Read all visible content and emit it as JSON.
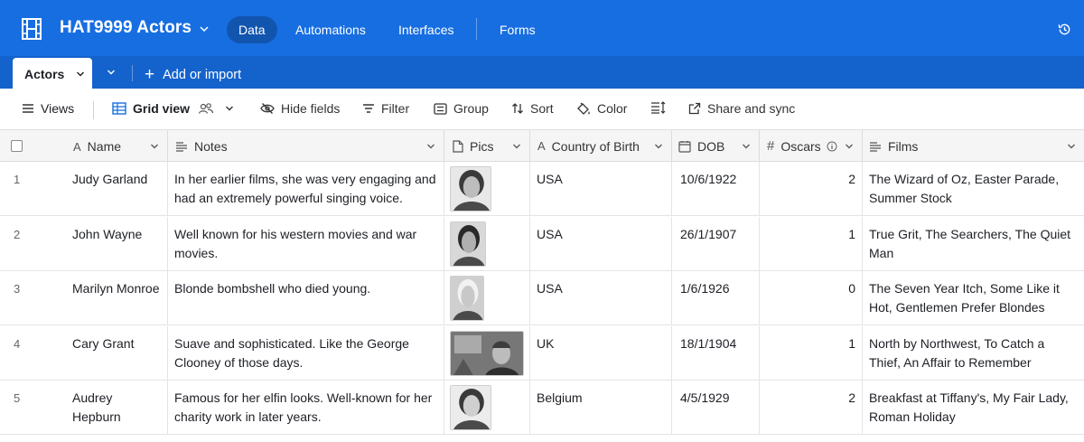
{
  "app": {
    "base_title": "HAT9999 Actors",
    "nav": [
      "Data",
      "Automations",
      "Interfaces",
      "Forms"
    ],
    "active_nav": "Data"
  },
  "tabs": {
    "active_table": "Actors",
    "add_label": "Add or import"
  },
  "toolbar": {
    "views": "Views",
    "grid_view": "Grid view",
    "hide_fields": "Hide fields",
    "filter": "Filter",
    "group": "Group",
    "sort": "Sort",
    "color": "Color",
    "share": "Share and sync"
  },
  "columns": {
    "name": "Name",
    "notes": "Notes",
    "pics": "Pics",
    "country": "Country of Birth",
    "dob": "DOB",
    "oscars": "Oscars",
    "films": "Films"
  },
  "rows": [
    {
      "num": "1",
      "name_1": "Judy Garland",
      "name_2": "",
      "notes_1": "In her earlier films, she was very engaging and",
      "notes_2": "had an extremely powerful singing voice.",
      "country": "USA",
      "dob": "10/6/1922",
      "oscars": "2",
      "films_1": "The Wizard of Oz, Easter Parade,",
      "films_2": "Summer Stock"
    },
    {
      "num": "2",
      "name_1": "John Wayne",
      "name_2": "",
      "notes_1": "Well known for his western movies and war",
      "notes_2": "movies.",
      "country": "USA",
      "dob": "26/1/1907",
      "oscars": "1",
      "films_1": "True Grit, The Searchers, The Quiet",
      "films_2": "Man"
    },
    {
      "num": "3",
      "name_1": "Marilyn Monroe",
      "name_2": "",
      "notes_1": "Blonde bombshell who died young.",
      "notes_2": "",
      "country": "USA",
      "dob": "1/6/1926",
      "oscars": "0",
      "films_1": "The Seven Year Itch, Some Like it",
      "films_2": "Hot, Gentlemen Prefer Blondes"
    },
    {
      "num": "4",
      "name_1": "Cary Grant",
      "name_2": "",
      "notes_1": "Suave and sophisticated. Like the George",
      "notes_2": "Clooney of those days.",
      "country": "UK",
      "dob": "18/1/1904",
      "oscars": "1",
      "films_1": "North by Northwest, To Catch a",
      "films_2": "Thief, An Affair to Remember"
    },
    {
      "num": "5",
      "name_1": "Audrey",
      "name_2": "Hepburn",
      "notes_1": "Famous for her elfin looks. Well-known for her",
      "notes_2": "charity work in later years.",
      "country": "Belgium",
      "dob": "4/5/1929",
      "oscars": "2",
      "films_1": "Breakfast at Tiffany's, My Fair Lady,",
      "films_2": "Roman Holiday"
    }
  ],
  "colors": {
    "appbar": "#176ee1",
    "tabsbar": "#1463cc"
  }
}
